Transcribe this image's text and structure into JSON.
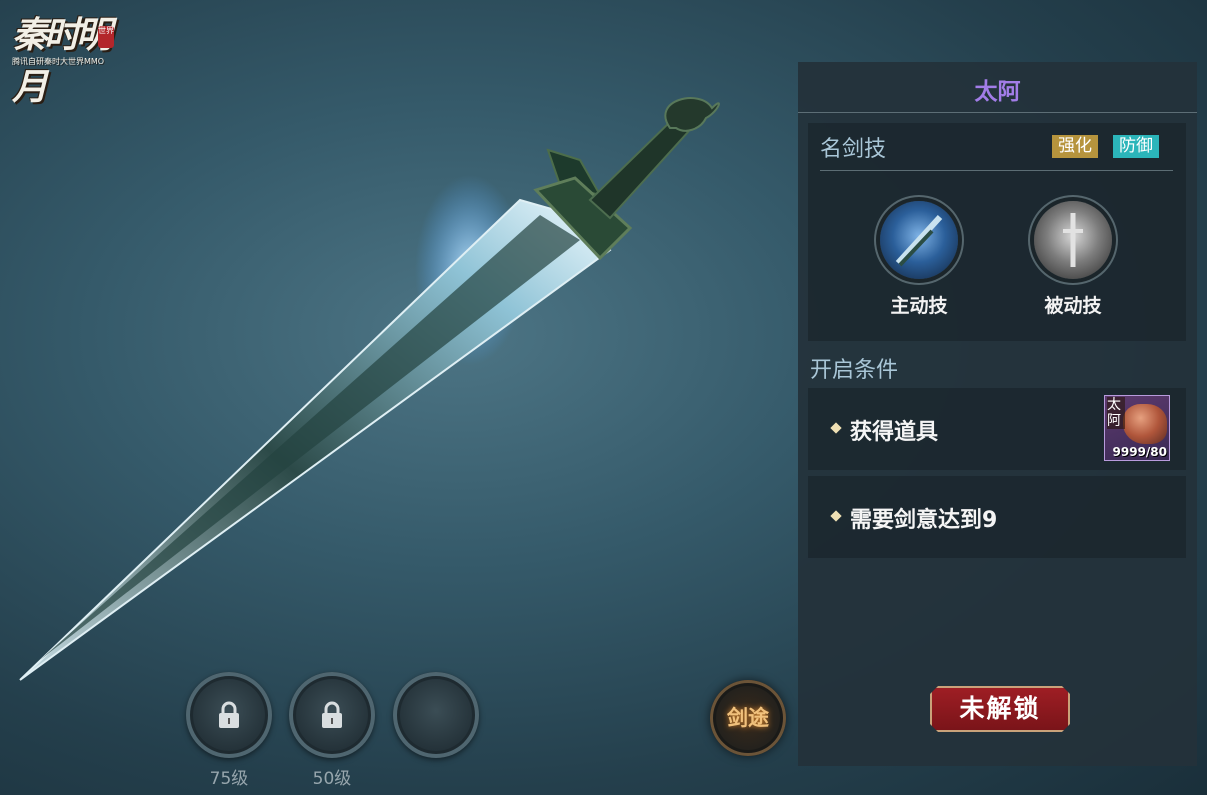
{
  "logo": {
    "title": "秦时明月",
    "seal": "世界",
    "subtitle": "腾讯自研秦时大世界MMO"
  },
  "slots": [
    {
      "label": "75级",
      "locked": true
    },
    {
      "label": "50级",
      "locked": true
    },
    {
      "label": "",
      "locked": false
    }
  ],
  "jiantu_button": "剑途",
  "panel": {
    "title": "太阿",
    "skills": {
      "header": "名剑技",
      "tags": [
        "强化",
        "防御"
      ],
      "active": "主动技",
      "passive": "被动技"
    },
    "conditions_title": "开启条件",
    "conditions": [
      {
        "text": "获得道具",
        "item": {
          "name": "太阿",
          "count": "9999/80"
        }
      },
      {
        "text": "需要剑意达到9"
      }
    ],
    "unlock_button": "未解锁"
  },
  "colors": {
    "title": "#a27de8",
    "tag_qianghua": "#b6943d",
    "tag_fangyu": "#2bb5ba",
    "unlock": "#9e1e24"
  }
}
